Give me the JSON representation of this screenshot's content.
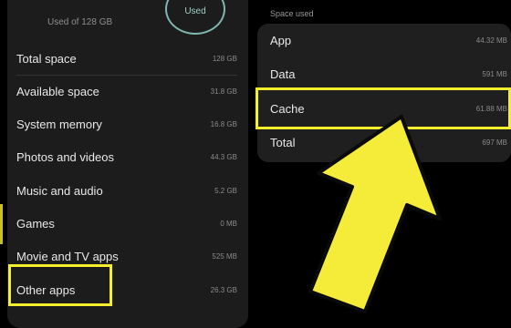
{
  "storage": {
    "used_of": "Used of 128 GB",
    "ring_label": "Used",
    "rows": [
      {
        "label": "Total space",
        "value": "128 GB"
      },
      {
        "label": "Available space",
        "value": "31.8 GB"
      },
      {
        "label": "System memory",
        "value": "16.8 GB"
      },
      {
        "label": "Photos and videos",
        "value": "44.3 GB"
      },
      {
        "label": "Music and audio",
        "value": "5.2 GB"
      },
      {
        "label": "Games",
        "value": "0 MB"
      },
      {
        "label": "Movie and TV apps",
        "value": "525 MB"
      },
      {
        "label": "Other apps",
        "value": "26.3 GB"
      }
    ]
  },
  "space_used": {
    "title": "Space used",
    "rows": [
      {
        "label": "App",
        "value": "44.32 MB"
      },
      {
        "label": "Data",
        "value": "591 MB"
      },
      {
        "label": "Cache",
        "value": "61.88 MB"
      },
      {
        "label": "Total",
        "value": "697 MB"
      }
    ]
  },
  "colors": {
    "highlight": "#f3ee2e",
    "arrow": "#f5ec3a",
    "ring": "#7fb6ad"
  }
}
